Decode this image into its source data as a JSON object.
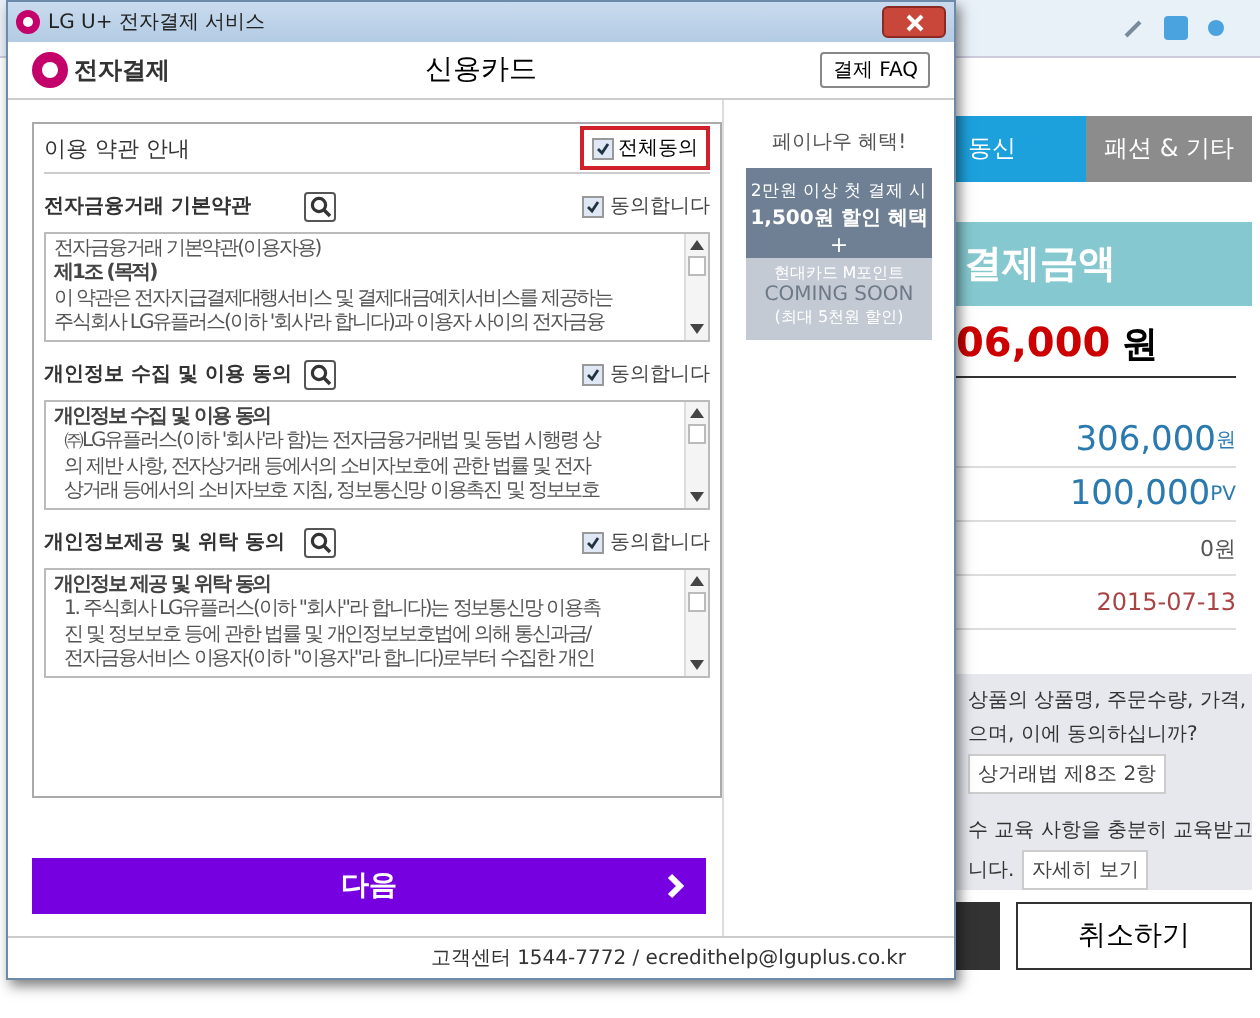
{
  "window": {
    "title": "LG U+ 전자결제 서비스"
  },
  "header": {
    "brand": "전자결제",
    "title": "신용카드",
    "faq_button": "결제 FAQ"
  },
  "terms": {
    "heading": "이용 약관 안내",
    "agree_all": {
      "label": "전체동의",
      "checked": true
    },
    "sections": [
      {
        "title": "전자금융거래 기본약관",
        "agree": {
          "label": "동의합니다",
          "checked": true
        },
        "lines": [
          {
            "text": "전자금융거래 기본약관(이용자용)",
            "bold": false,
            "indent": false
          },
          {
            "text": "제1조 (목적)",
            "bold": true,
            "indent": false
          },
          {
            "text": "이 약관은 전자지급결제대행서비스 및 결제대금예치서비스를 제공하는",
            "bold": false,
            "indent": false
          },
          {
            "text": "주식회사 LG유플러스(이하 '회사'라 합니다)과 이용자 사이의 전자금융",
            "bold": false,
            "indent": false
          }
        ]
      },
      {
        "title": "개인정보 수집 및 이용 동의",
        "agree": {
          "label": "동의합니다",
          "checked": true
        },
        "lines": [
          {
            "text": "개인정보 수집 및 이용 동의",
            "bold": true,
            "indent": false
          },
          {
            "text": "㈜LG유플러스(이하 '회사'라 함)는 전자금융거래법 및 동법 시행령 상",
            "bold": false,
            "indent": true
          },
          {
            "text": "의 제반 사항, 전자상거래 등에서의 소비자보호에 관한 법률 및 전자",
            "bold": false,
            "indent": true
          },
          {
            "text": "상거래 등에서의 소비자보호 지침, 정보통신망 이용촉진 및 정보보호",
            "bold": false,
            "indent": true
          }
        ]
      },
      {
        "title": "개인정보제공 및 위탁 동의",
        "agree": {
          "label": "동의합니다",
          "checked": true
        },
        "lines": [
          {
            "text": "개인정보 제공 및 위탁 동의",
            "bold": true,
            "indent": false
          },
          {
            "text": "1. 주식회사 LG유플러스(이하 \"회사\"라 합니다)는 정보통신망 이용촉",
            "bold": false,
            "indent": true
          },
          {
            "text": "진 및 정보보호 등에 관한 법률 및 개인정보보호법에 의해 통신과금/",
            "bold": false,
            "indent": true
          },
          {
            "text": "전자금융서비스 이용자(이하 \"이용자\"라 합니다)로부터 수집한 개인",
            "bold": false,
            "indent": true
          }
        ]
      }
    ]
  },
  "next_button": "다음",
  "footer": "고객센터 1544-7772 / ecredithelp@lguplus.co.kr",
  "promo": {
    "title": "페이나우 혜택!",
    "line_1": "2만원 이상 첫 결제 시",
    "line_2": "1,500원 할인 혜택",
    "plus": "+",
    "line_3": "현대카드 M포인트",
    "line_4": "COMING SOON",
    "line_5": "(최대 5천원 할인)"
  },
  "background": {
    "tabs": [
      {
        "label": "동신",
        "selected": true
      },
      {
        "label": "패션 & 기타",
        "selected": false
      }
    ],
    "amount_heading": "결제금액",
    "amount": "06,000",
    "amount_unit": "원",
    "rows": [
      {
        "value": "306,000",
        "unit": "원",
        "kind": "price"
      },
      {
        "value": "100,000",
        "unit": "PV",
        "kind": "price"
      },
      {
        "value": "0원",
        "unit": "",
        "kind": "plain"
      },
      {
        "value": "2015-07-13",
        "unit": "",
        "kind": "date"
      }
    ],
    "notice_1": [
      "상품의 상품명, 주문수량, 가격,",
      "으며, 이에 동의하십니까?"
    ],
    "notice_1_button": "상거래법 제8조 2항",
    "notice_2": [
      "수 교육 사항을 충분히 교육받고",
      "니다."
    ],
    "notice_2_button": "자세히 보기",
    "cancel_button": "취소하기"
  }
}
